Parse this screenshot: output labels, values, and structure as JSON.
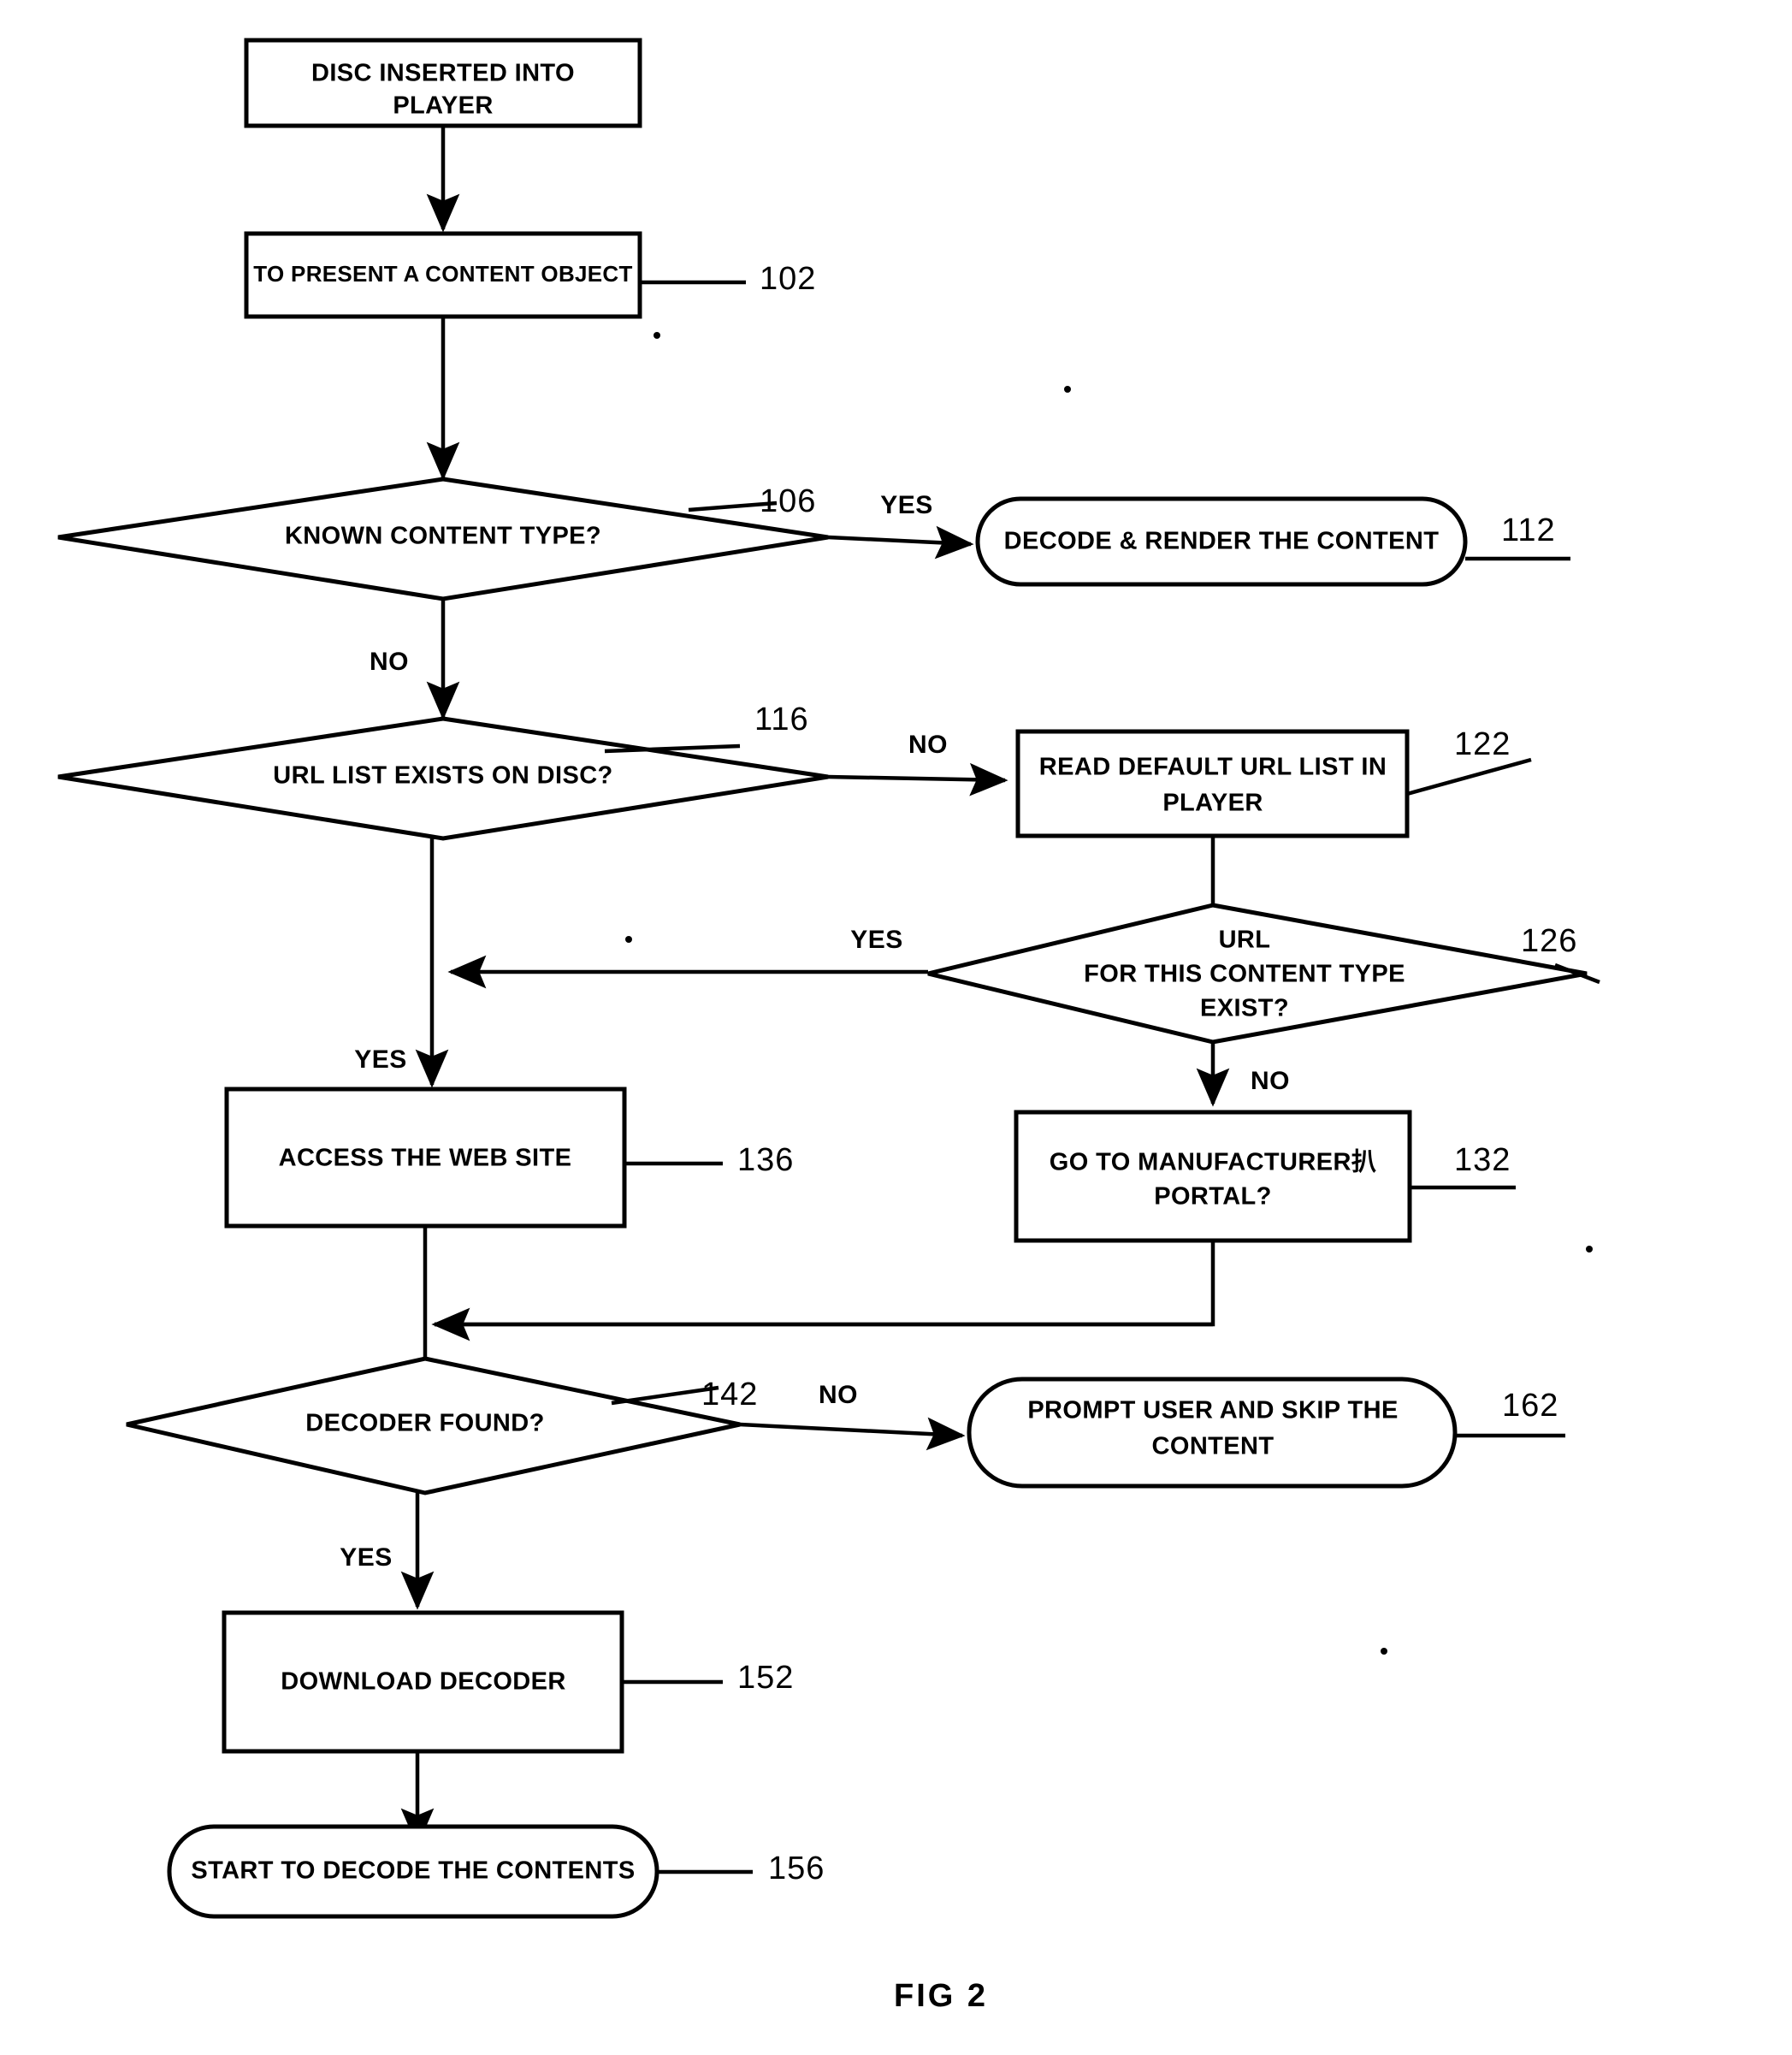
{
  "figure": {
    "caption": "FIG  2",
    "title": "FIG 2"
  },
  "nodes": {
    "n1": {
      "id": "disc-inserted",
      "shape": "process",
      "lines": [
        "DISC INSERTED INTO",
        "PLAYER"
      ],
      "ref": ""
    },
    "n2": {
      "id": "present-content-object",
      "shape": "process",
      "lines": [
        "TO PRESENT A CONTENT OBJECT"
      ],
      "ref": "102"
    },
    "n3": {
      "id": "known-content-type",
      "shape": "decision",
      "lines": [
        "KNOWN CONTENT TYPE?"
      ],
      "ref": "106"
    },
    "n4": {
      "id": "decode-render-content",
      "shape": "terminator",
      "lines": [
        "DECODE & RENDER THE CONTENT"
      ],
      "ref": "112"
    },
    "n5": {
      "id": "url-list-exists-on-disc",
      "shape": "decision",
      "lines": [
        "URL LIST EXISTS ON DISC?"
      ],
      "ref": "116"
    },
    "n6": {
      "id": "read-default-url-list",
      "shape": "process",
      "lines": [
        "READ DEFAULT URL LIST IN",
        "PLAYER"
      ],
      "ref": "122"
    },
    "n7": {
      "id": "url-for-content-type-exist",
      "shape": "decision",
      "lines": [
        "URL",
        "FOR THIS CONTENT TYPE",
        "EXIST?"
      ],
      "ref": "126"
    },
    "n8": {
      "id": "access-web-site",
      "shape": "process",
      "lines": [
        "ACCESS THE WEB SITE"
      ],
      "ref": "136"
    },
    "n9": {
      "id": "go-to-manufacturer-portal",
      "shape": "process",
      "lines": [
        "GO TO MANUFACTURER扒",
        "PORTAL?"
      ],
      "ref": "132"
    },
    "n10": {
      "id": "decoder-found",
      "shape": "decision",
      "lines": [
        "DECODER FOUND?"
      ],
      "ref": "142"
    },
    "n11": {
      "id": "prompt-user-skip-content",
      "shape": "terminator",
      "lines": [
        "PROMPT USER AND SKIP THE",
        "CONTENT"
      ],
      "ref": "162"
    },
    "n12": {
      "id": "download-decoder",
      "shape": "process",
      "lines": [
        "DOWNLOAD DECODER"
      ],
      "ref": "152"
    },
    "n13": {
      "id": "start-to-decode-contents",
      "shape": "terminator",
      "lines": [
        "START TO DECODE THE CONTENTS"
      ],
      "ref": "156"
    }
  },
  "branches": {
    "b1": "YES",
    "b2": "NO",
    "b3": "NO",
    "b4": "YES",
    "b5": "NO",
    "b6": "YES",
    "b7": "NO",
    "b8": "YES"
  }
}
